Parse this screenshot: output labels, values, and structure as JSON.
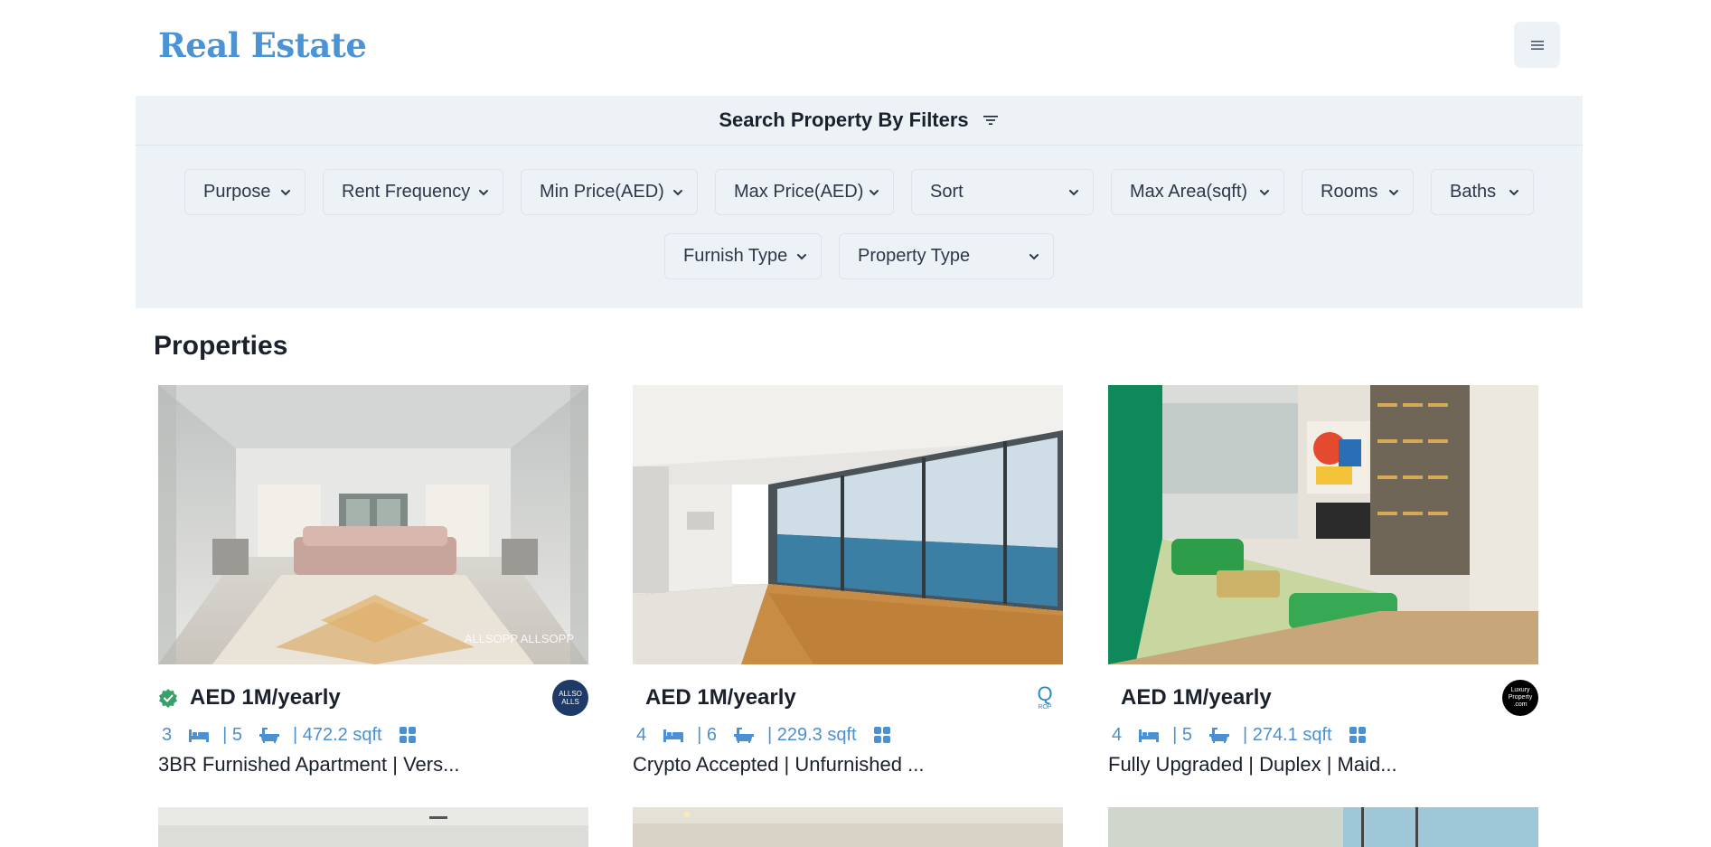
{
  "brand": "Real Estate",
  "menu_icon": "hamburger-icon",
  "filters": {
    "title": "Search Property By Filters",
    "row1": [
      {
        "label": "Purpose"
      },
      {
        "label": "Rent Frequency"
      },
      {
        "label": "Min Price(AED)"
      },
      {
        "label": "Max Price(AED)"
      },
      {
        "label": "Sort"
      },
      {
        "label": "Max Area(sqft)"
      },
      {
        "label": "Rooms"
      },
      {
        "label": "Baths"
      }
    ],
    "row2": [
      {
        "label": "Furnish Type"
      },
      {
        "label": "Property Type"
      }
    ]
  },
  "section_title": "Properties",
  "properties": [
    {
      "price": "AED 1M/yearly",
      "verified": true,
      "rooms": "3",
      "baths": "| 5",
      "area": "| 472.2 sqft",
      "title": "3BR Furnished Apartment | Vers...",
      "agency_logo_text": "ALLSO ALLS",
      "watermark": "ALLSOPP ALLSOPP"
    },
    {
      "price": "AED 1M/yearly",
      "verified": false,
      "rooms": "4",
      "baths": "| 6",
      "area": "| 229.3 sqft",
      "title": "Crypto Accepted | Unfurnished ...",
      "agency_logo_text": "Q",
      "agency_logo_subtext": "ROP"
    },
    {
      "price": "AED 1M/yearly",
      "verified": false,
      "rooms": "4",
      "baths": "| 5",
      "area": "| 274.1 sqft",
      "title": "Fully Upgraded | Duplex | Maid...",
      "agency_logo_text": "Luxury Property .com"
    }
  ],
  "colors": {
    "brand": "#4a94d6",
    "panel": "#edf2f7",
    "stats": "#4a90d2",
    "verified": "#38a169"
  }
}
